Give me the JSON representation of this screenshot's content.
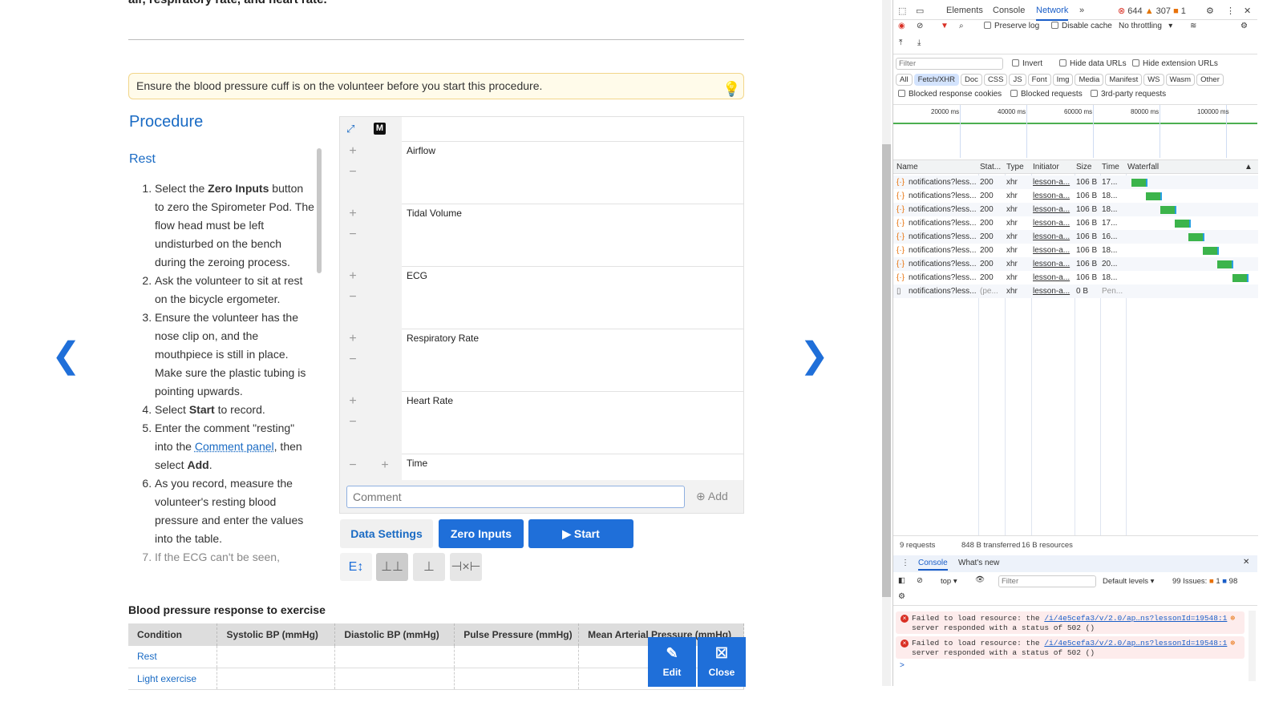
{
  "page": {
    "clipped_intro": "air, respiratory rate, and heart rate.",
    "tip": "Ensure the blood pressure cuff is on the volunteer before you start this procedure.",
    "procedure_title": "Procedure",
    "rest_title": "Rest",
    "steps": [
      [
        {
          "t": "Select the "
        },
        {
          "t": "Zero Inputs",
          "b": true
        },
        {
          "t": " button to zero the Spirometer Pod. The flow head must be left undisturbed on the bench during the zeroing process."
        }
      ],
      [
        {
          "t": "Ask the volunteer to sit at rest on the bicycle ergometer."
        }
      ],
      [
        {
          "t": "Ensure the volunteer has the nose clip on, and the mouthpiece is still in place. Make sure the plastic tubing is pointing upwards."
        }
      ],
      [
        {
          "t": "Select "
        },
        {
          "t": "Start",
          "b": true
        },
        {
          "t": " to record."
        }
      ],
      [
        {
          "t": "Enter the comment \"resting\" into the "
        },
        {
          "t": "Comment panel",
          "link": true
        },
        {
          "t": ", then select "
        },
        {
          "t": "Add",
          "b": true
        },
        {
          "t": "."
        }
      ],
      [
        {
          "t": "As you record, measure the volunteer's resting blood pressure and enter the values into the table."
        }
      ],
      [
        {
          "t": "If the ECG can't be seen,"
        }
      ]
    ],
    "chart": {
      "m_badge": "M",
      "channels": [
        "Airflow",
        "Tidal Volume",
        "ECG",
        "Respiratory Rate",
        "Heart Rate"
      ],
      "time_label": "Time",
      "comment_placeholder": "Comment",
      "add_label": "Add"
    },
    "buttons": {
      "data_settings": "Data Settings",
      "zero_inputs": "Zero Inputs",
      "start": "▶ Start"
    },
    "table": {
      "title": "Blood pressure response to exercise",
      "headers": [
        "Condition",
        "Systolic BP (mmHg)",
        "Diastolic BP (mmHg)",
        "Pulse Pressure (mmHg)",
        "Mean Arterial Pressure (mmHg)"
      ],
      "rows": [
        "Rest",
        "Light exercise"
      ]
    },
    "edit_label": "Edit",
    "close_label": "Close"
  },
  "devtools": {
    "tabs": [
      "Elements",
      "Console",
      "Network"
    ],
    "active_tab": "Network",
    "errors": "644",
    "warnings": "307",
    "issues": "1",
    "preserve_log": "Preserve log",
    "disable_cache": "Disable cache",
    "throttling": "No throttling",
    "filter_placeholder": "Filter",
    "invert": "Invert",
    "hide_data_urls": "Hide data URLs",
    "hide_ext_urls": "Hide extension URLs",
    "types": [
      "All",
      "Fetch/XHR",
      "Doc",
      "CSS",
      "JS",
      "Font",
      "Img",
      "Media",
      "Manifest",
      "WS",
      "Wasm",
      "Other"
    ],
    "active_type": "Fetch/XHR",
    "blocked_cookies": "Blocked response cookies",
    "blocked_requests": "Blocked requests",
    "third_party": "3rd-party requests",
    "timeline_ticks": [
      "20000 ms",
      "40000 ms",
      "60000 ms",
      "80000 ms",
      "100000 ms"
    ],
    "columns": [
      "Name",
      "Stat...",
      "Type",
      "Initiator",
      "Size",
      "Time",
      "Waterfall"
    ],
    "requests": [
      {
        "name": "notifications?less...",
        "status": "200",
        "type": "xhr",
        "initiator": "lesson-a...",
        "size": "106 B",
        "time": "17...",
        "wf": 0.02
      },
      {
        "name": "notifications?less...",
        "status": "200",
        "type": "xhr",
        "initiator": "lesson-a...",
        "size": "106 B",
        "time": "18...",
        "wf": 0.14
      },
      {
        "name": "notifications?less...",
        "status": "200",
        "type": "xhr",
        "initiator": "lesson-a...",
        "size": "106 B",
        "time": "18...",
        "wf": 0.26
      },
      {
        "name": "notifications?less...",
        "status": "200",
        "type": "xhr",
        "initiator": "lesson-a...",
        "size": "106 B",
        "time": "17...",
        "wf": 0.38
      },
      {
        "name": "notifications?less...",
        "status": "200",
        "type": "xhr",
        "initiator": "lesson-a...",
        "size": "106 B",
        "time": "16...",
        "wf": 0.49
      },
      {
        "name": "notifications?less...",
        "status": "200",
        "type": "xhr",
        "initiator": "lesson-a...",
        "size": "106 B",
        "time": "18...",
        "wf": 0.61
      },
      {
        "name": "notifications?less...",
        "status": "200",
        "type": "xhr",
        "initiator": "lesson-a...",
        "size": "106 B",
        "time": "20...",
        "wf": 0.73
      },
      {
        "name": "notifications?less...",
        "status": "200",
        "type": "xhr",
        "initiator": "lesson-a...",
        "size": "106 B",
        "time": "18...",
        "wf": 0.86
      },
      {
        "name": "notifications?less...",
        "status": "(pe...",
        "type": "xhr",
        "initiator": "lesson-a...",
        "size": "0 B",
        "time": "Pen...",
        "wf": null
      }
    ],
    "summary": [
      "9 requests",
      "848 B transferred",
      "16 B resources"
    ],
    "drawer_tabs": [
      "Console",
      "What's new"
    ],
    "context": "top",
    "console_filter_placeholder": "Filter",
    "levels": "Default levels",
    "issues_label": "99 Issues:",
    "issues_warn": "1",
    "issues_info": "98",
    "messages": [
      {
        "text": "Failed to load resource: the ",
        "link": "/i/4e5cefa3/v/2.0/ap…ns?lessonId=19548:1",
        "text2": "server responded with a status of 502 ()"
      },
      {
        "text": "Failed to load resource: the ",
        "link": "/i/4e5cefa3/v/2.0/ap…ns?lessonId=19548:1",
        "text2": "server responded with a status of 502 ()"
      }
    ],
    "prompt": ">"
  }
}
